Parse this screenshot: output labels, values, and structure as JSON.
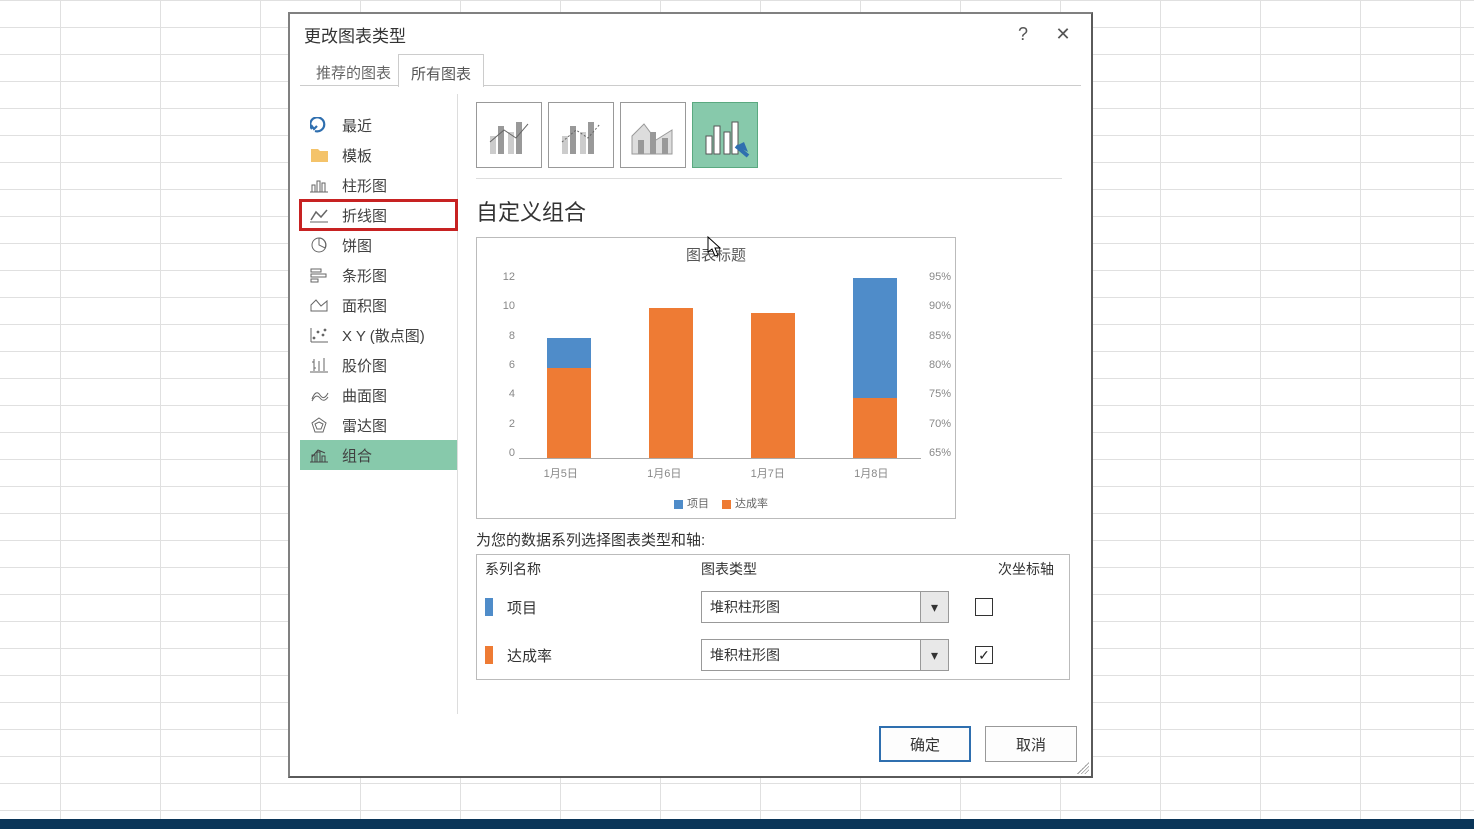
{
  "dialog": {
    "title": "更改图表类型",
    "help": "?",
    "close": "✕"
  },
  "tabs": {
    "recommended": "推荐的图表",
    "all": "所有图表"
  },
  "categories": [
    {
      "id": "recent",
      "label": "最近"
    },
    {
      "id": "template",
      "label": "模板"
    },
    {
      "id": "column",
      "label": "柱形图"
    },
    {
      "id": "line",
      "label": "折线图"
    },
    {
      "id": "pie",
      "label": "饼图"
    },
    {
      "id": "bar",
      "label": "条形图"
    },
    {
      "id": "area",
      "label": "面积图"
    },
    {
      "id": "scatter",
      "label": "X Y (散点图)"
    },
    {
      "id": "stock",
      "label": "股价图"
    },
    {
      "id": "surface",
      "label": "曲面图"
    },
    {
      "id": "radar",
      "label": "雷达图"
    },
    {
      "id": "combo",
      "label": "组合"
    }
  ],
  "combo_title": "自定义组合",
  "series_prompt": "为您的数据系列选择图表类型和轴:",
  "series_headers": {
    "name": "系列名称",
    "type": "图表类型",
    "secondary": "次坐标轴"
  },
  "series": [
    {
      "name": "项目",
      "color": "#4f8cc9",
      "chart_type": "堆积柱形图",
      "secondary": false
    },
    {
      "name": "达成率",
      "color": "#ee7b34",
      "chart_type": "堆积柱形图",
      "secondary": true
    }
  ],
  "buttons": {
    "ok": "确定",
    "cancel": "取消"
  },
  "chart_data": {
    "type": "bar",
    "title": "图表标题",
    "categories": [
      "1月5日",
      "1月6日",
      "1月7日",
      "1月8日"
    ],
    "series": [
      {
        "name": "项目",
        "values": [
          8,
          10,
          9.7,
          12
        ]
      },
      {
        "name": "达成率",
        "values": [
          6,
          10,
          9.7,
          4
        ]
      }
    ],
    "ylabel": "",
    "ylim_left": [
      0,
      12
    ],
    "yticks_left": [
      0,
      2,
      4,
      6,
      8,
      10,
      12
    ],
    "ylim_right": [
      65,
      95
    ],
    "yticks_right": [
      "95%",
      "90%",
      "85%",
      "80%",
      "75%",
      "70%",
      "65%"
    ],
    "legend": [
      "项目",
      "达成率"
    ]
  }
}
